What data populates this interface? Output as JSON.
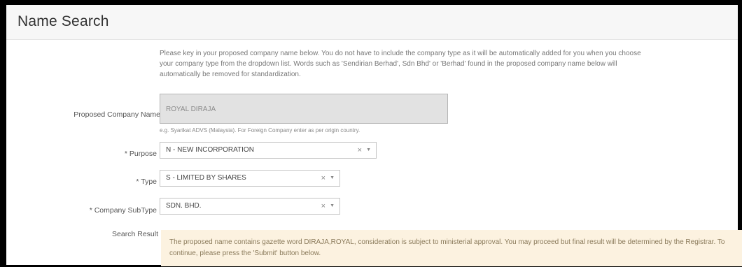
{
  "page": {
    "title": "Name Search"
  },
  "intro": {
    "text": "Please key in your proposed company name below. You do not have to include the company type as it will be automatically added for you when you choose your company type from the dropdown list. Words such as 'Sendirian Berhad', Sdn Bhd' or 'Berhad' found in the proposed company name below will automatically be removed for standardization."
  },
  "form": {
    "company_name": {
      "label": "Proposed Company Name",
      "value": "ROYAL DIRAJA",
      "hint": "e.g. Syarikat ADVS (Malaysia). For Foreign Company enter as per origin country."
    },
    "purpose": {
      "label": "* Purpose",
      "value": "N - NEW INCORPORATION",
      "clear": "×",
      "caret": "▼"
    },
    "type": {
      "label": "* Type",
      "value": "S - LIMITED BY SHARES",
      "clear": "×",
      "caret": "▼"
    },
    "subtype": {
      "label": "* Company SubType",
      "value": "SDN. BHD.",
      "clear": "×",
      "caret": "▼"
    },
    "search_result": {
      "label": "Search Result",
      "message": "The proposed name contains gazette word DIRAJA,ROYAL, consideration is subject to ministerial approval. You may proceed but final result will be determined by the Registrar. To continue, please press the 'Submit' button below."
    }
  },
  "colors": {
    "result_background": "#fcf2e0",
    "header_background": "#f7f7f7",
    "input_disabled": "#e2e2e2"
  }
}
